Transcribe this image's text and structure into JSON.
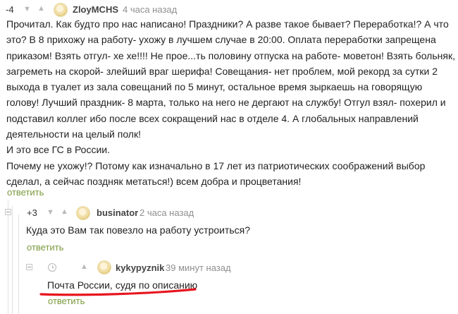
{
  "comment1": {
    "rating": "-4",
    "username": "ZloyMCHS",
    "time": "4 часа назад",
    "lines": [
      "Прочитал. Как будто про нас написано! Праздники? А разве такое бывает? Переработка!? А что",
      "это? В 8 прихожу на работу- ухожу в лучшем случае в 20:00. Оплата переработки запрещена",
      "приказом! Взять отгул- хе хе!!!! Не прое...ть половину отпуска на работе- моветон! Взять больняк,",
      "загреметь на скорой- злейший враг шерифа! Совещания- нет проблем, мой рекорд за сутки 2",
      "выхода в туалет из зала совещаний по 5 минут, остальное время зыркаешь на говорящую",
      "голову! Лучший праздник- 8 марта, только на него не дергают на службу! Отгул взял- похерил и",
      "подставил коллег ибо после всех сокращений нас в отделе 4. А глобальных направлений",
      "деятельности на целый полк!",
      "И это все ГС в России.",
      "Почему не ухожу!? Потому как изначально в 17 лет из патриотических соображений выбор",
      "сделал, а сейчас поздняк метаться!) всем добра и процветания!"
    ],
    "reply": "ответить"
  },
  "comment2": {
    "rating": "+3",
    "username": "businator",
    "time": "2 часа назад",
    "text": "Куда это Вам так повезло на работу устроиться?",
    "reply": "ответить"
  },
  "comment3": {
    "username": "kykypyznik",
    "time": "39 минут назад",
    "text": "Почта России, судя по описанию",
    "reply": "ответить"
  },
  "colors": {
    "reply_link": "#7a9a3c",
    "underline_annotation": "#e8141e"
  },
  "icons": [
    "arrow-down-icon",
    "arrow-up-icon",
    "collapse-icon",
    "clock-icon",
    "avatar"
  ]
}
